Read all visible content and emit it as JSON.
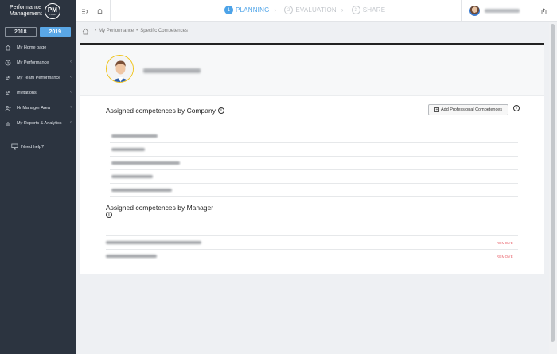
{
  "logo": {
    "line1": "Performance",
    "line2": "Management",
    "badge": "PM",
    "badge_sub": "TOOL"
  },
  "years": [
    {
      "label": "2018",
      "active": false
    },
    {
      "label": "2019",
      "active": true
    }
  ],
  "sidebar": {
    "items": [
      {
        "label": "My Home page",
        "icon": "home-icon",
        "has_chevron": false
      },
      {
        "label": "My Performance",
        "icon": "clock-icon",
        "has_chevron": true
      },
      {
        "label": "My Team Performance",
        "icon": "team-icon",
        "has_chevron": true
      },
      {
        "label": "Invitations",
        "icon": "invite-icon",
        "has_chevron": true
      },
      {
        "label": "Hr Manager Area",
        "icon": "manager-icon",
        "has_chevron": true
      },
      {
        "label": "My Reports & Analytics",
        "icon": "reports-icon",
        "has_chevron": true
      }
    ],
    "help_label": "Need help?"
  },
  "topbar": {
    "steps": [
      {
        "num": "1",
        "label": "PLANNING",
        "current": true
      },
      {
        "num": "2",
        "label": "EVALUATION",
        "current": false
      },
      {
        "num": "3",
        "label": "SHARE",
        "current": false
      }
    ],
    "step_arrow": "›"
  },
  "breadcrumb": {
    "items": [
      "My Performance",
      "Specific Competences"
    ],
    "sep": "•"
  },
  "company_section": {
    "title": "Assigned competences by Company",
    "add_button_label": "Add Professional Competences"
  },
  "manager_section": {
    "title": "Assigned competences by Manager",
    "remove_label": "REMOVE"
  },
  "colors": {
    "accent": "#4da3e8",
    "sidebar_bg": "#2c3440",
    "remove": "#e9616a",
    "avatar_ring": "#f0c419"
  }
}
